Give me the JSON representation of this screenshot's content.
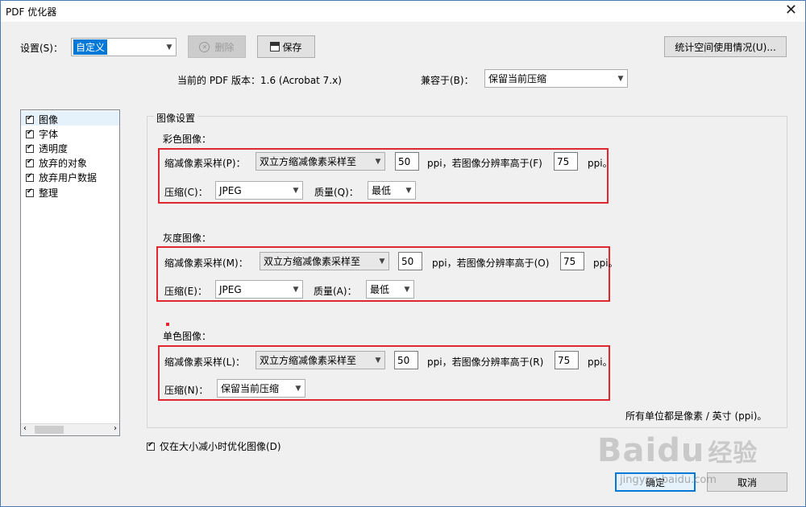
{
  "window": {
    "title": "PDF 优化器",
    "close_icon": "✕"
  },
  "settings": {
    "label": "设置(S)：",
    "value": "自定义",
    "delete_label": "删除",
    "save_label": "保存",
    "space_usage_label": "统计空间使用情况(U)..."
  },
  "version": {
    "text": "当前的 PDF 版本：1.6 (Acrobat 7.x)"
  },
  "compat": {
    "label": "兼容于(B)：",
    "value": "保留当前压缩"
  },
  "panel_list": [
    {
      "label": "图像",
      "checked": true
    },
    {
      "label": "字体",
      "checked": true
    },
    {
      "label": "透明度",
      "checked": true
    },
    {
      "label": "放弃的对象",
      "checked": true
    },
    {
      "label": "放弃用户数据",
      "checked": true
    },
    {
      "label": "整理",
      "checked": true
    }
  ],
  "image_settings": {
    "title": "图像设置",
    "color": {
      "heading": "彩色图像：",
      "downsample_label": "缩减像素采样(P)：",
      "downsample_value": "双立方缩减像素采样至",
      "ppi_value": "50",
      "ppi_text": "ppi，若图像分辨率高于(F)",
      "threshold_value": "75",
      "ppi_suffix": "ppi。",
      "compress_label": "压缩(C)：",
      "compress_value": "JPEG",
      "quality_label": "质量(Q)：",
      "quality_value": "最低"
    },
    "gray": {
      "heading": "灰度图像：",
      "downsample_label": "缩减像素采样(M)：",
      "downsample_value": "双立方缩减像素采样至",
      "ppi_value": "50",
      "ppi_text": "ppi，若图像分辨率高于(O)",
      "threshold_value": "75",
      "ppi_suffix": "ppi。",
      "compress_label": "压缩(E)：",
      "compress_value": "JPEG",
      "quality_label": "质量(A)：",
      "quality_value": "最低"
    },
    "mono": {
      "heading": "单色图像：",
      "downsample_label": "缩减像素采样(L)：",
      "downsample_value": "双立方缩减像素采样至",
      "ppi_value": "50",
      "ppi_text": "ppi，若图像分辨率高于(R)",
      "threshold_value": "75",
      "ppi_suffix": "ppi。",
      "compress_label": "压缩(N)：",
      "compress_value": "保留当前压缩"
    },
    "units_note": "所有单位都是像素 / 英寸 (ppi)。"
  },
  "optimize_checkbox": {
    "label": "仅在大小减小时优化图像(D)",
    "checked": true
  },
  "buttons": {
    "ok": "确定",
    "cancel": "取消"
  },
  "watermark": {
    "brand": "Baidu",
    "suffix": "经验",
    "url": "jingyan.baidu.com"
  },
  "colors": {
    "accent": "#0078d7",
    "highlight_box": "#e0262e"
  }
}
